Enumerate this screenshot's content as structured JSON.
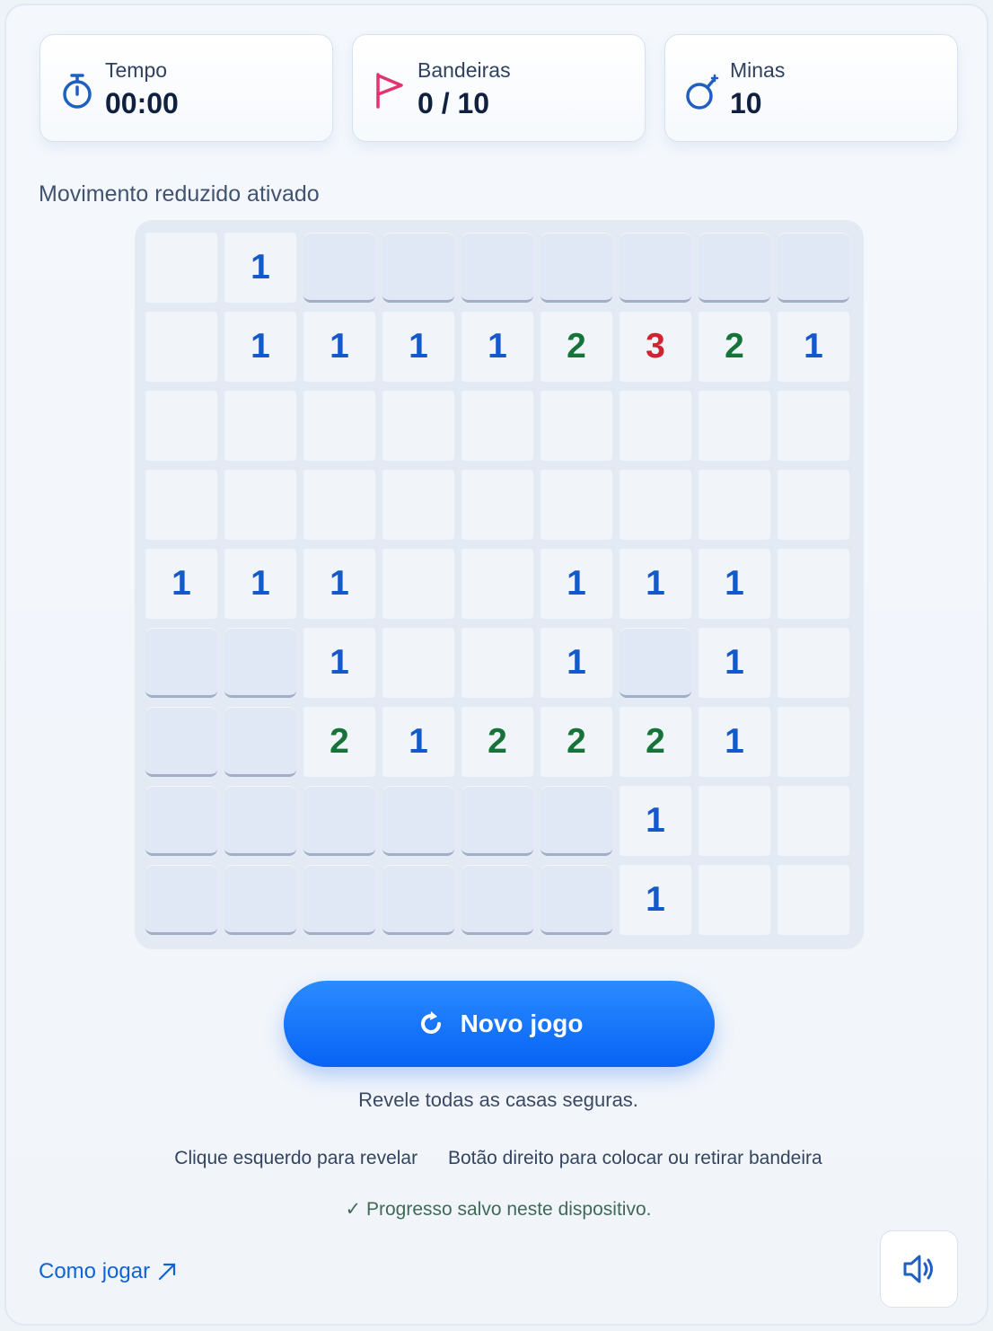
{
  "stats": {
    "time": {
      "label": "Tempo",
      "value": "00:00"
    },
    "flags": {
      "label": "Bandeiras",
      "value": "0 / 10"
    },
    "mines": {
      "label": "Minas",
      "value": "10"
    }
  },
  "motion_note": "Movimento reduzido ativado",
  "board": {
    "rows": 9,
    "cols": 9,
    "legend": "H = hidden, 0 = open empty, 1-8 = number",
    "grid": [
      [
        "0",
        "1",
        "H",
        "H",
        "H",
        "H",
        "H",
        "H",
        "H"
      ],
      [
        "0",
        "1",
        "1",
        "1",
        "1",
        "2",
        "3",
        "2",
        "1"
      ],
      [
        "0",
        "0",
        "0",
        "0",
        "0",
        "0",
        "0",
        "0",
        "0"
      ],
      [
        "0",
        "0",
        "0",
        "0",
        "0",
        "0",
        "0",
        "0",
        "0"
      ],
      [
        "1",
        "1",
        "1",
        "0",
        "0",
        "1",
        "1",
        "1",
        "0"
      ],
      [
        "H",
        "H",
        "1",
        "0",
        "0",
        "1",
        "H",
        "1",
        "0"
      ],
      [
        "H",
        "H",
        "2",
        "1",
        "2",
        "2",
        "2",
        "1",
        "0"
      ],
      [
        "H",
        "H",
        "H",
        "H",
        "H",
        "H",
        "1",
        "0",
        "0"
      ],
      [
        "H",
        "H",
        "H",
        "H",
        "H",
        "H",
        "1",
        "0",
        "0"
      ]
    ],
    "number_colors": {
      "1": "#1558c8",
      "2": "#177339",
      "3": "#cf2431"
    }
  },
  "new_game_label": "Novo jogo",
  "status_message": "Revele todas as casas seguras.",
  "instructions": {
    "left_click": "Clique esquerdo para revelar",
    "right_click": "Botão direito para colocar ou retirar bandeira"
  },
  "progress_note": "✓ Progresso salvo neste dispositivo.",
  "how_to_play": "Como jogar",
  "colors": {
    "accent": "#0763f5",
    "flag": "#e0356f",
    "hidden_cell": "#dfe8f4",
    "open_cell": "#f1f5f9"
  }
}
